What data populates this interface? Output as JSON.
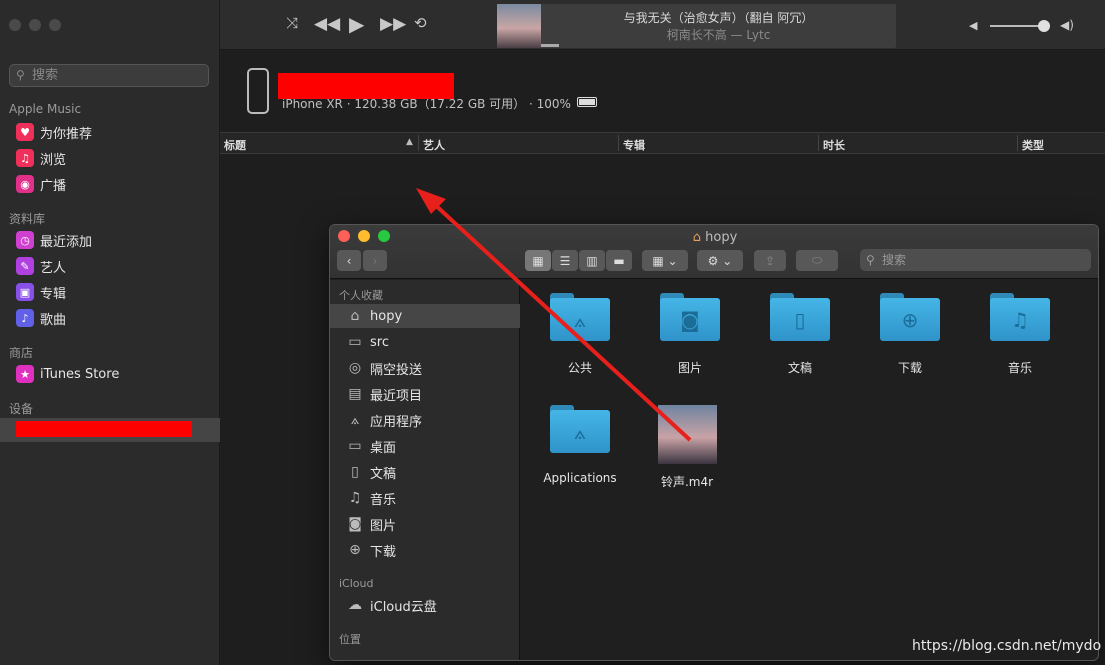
{
  "sidebar": {
    "search_placeholder": "搜索",
    "sections": {
      "apple_music": "Apple Music",
      "library": "资料库",
      "store": "商店",
      "devices": "设备"
    },
    "apple_music_items": [
      "为你推荐",
      "浏览",
      "广播"
    ],
    "library_items": [
      "最近添加",
      "艺人",
      "专辑",
      "歌曲"
    ],
    "store_items": [
      "iTunes Store"
    ]
  },
  "player": {
    "song_title": "与我无关（治愈女声）（翻自 阿冗）",
    "artist_line": "柯南长不高 — Lytc",
    "progress": 0.05,
    "volume": 0.9
  },
  "device": {
    "info": "iPhone XR · 120.38 GB（17.22 GB 可用） · 100%",
    "battery_level": 1.0
  },
  "columns": [
    "标题",
    "艺人",
    "专辑",
    "时长",
    "类型"
  ],
  "finder": {
    "title": "hopy",
    "search_placeholder": "搜索",
    "favorites_title": "个人收藏",
    "favorites": [
      "hopy",
      "src",
      "隔空投送",
      "最近项目",
      "应用程序",
      "桌面",
      "文稿",
      "音乐",
      "图片",
      "下载"
    ],
    "icloud_title": "iCloud",
    "icloud_items": [
      "iCloud云盘"
    ],
    "location_title": "位置",
    "items": [
      "公共",
      "图片",
      "文稿",
      "下载",
      "音乐",
      "Applications",
      "铃声.m4r"
    ]
  },
  "colors": {
    "redaction": "#ff0000",
    "arrow": "#e8201c",
    "folder": "#3aa8dd"
  },
  "watermark": "https://blog.csdn.net/mydo"
}
